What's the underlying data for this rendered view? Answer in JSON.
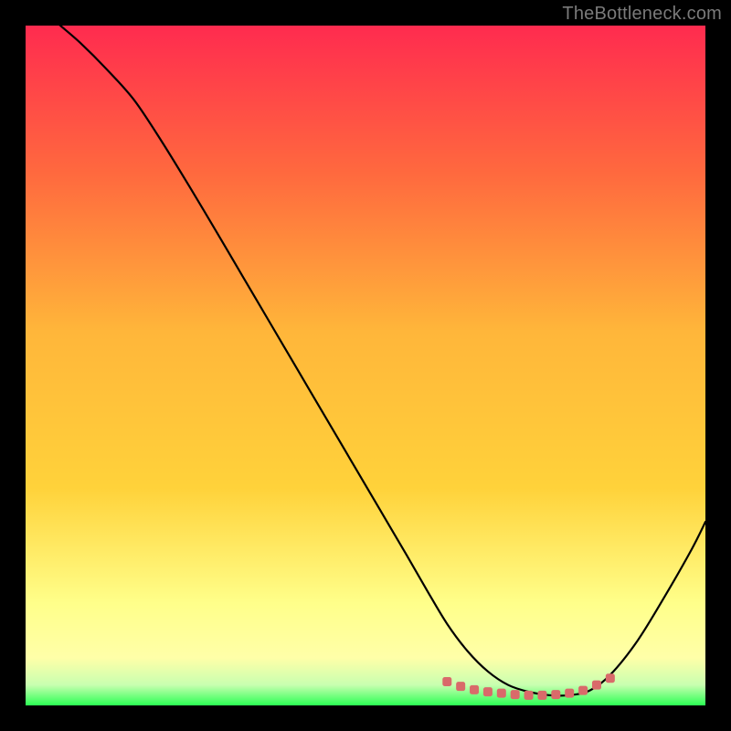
{
  "watermark": "TheBottleneck.com",
  "colors": {
    "background_black": "#000000",
    "gradient_top": "#ff2b4f",
    "gradient_mid_upper": "#ff7a3a",
    "gradient_mid": "#ffd23a",
    "gradient_mid_lower": "#ffff66",
    "gradient_lower": "#ffffa8",
    "gradient_bottom": "#2bff54",
    "curve_color": "#000000",
    "marker_color": "#d96a6a",
    "watermark_color": "#7a7a7a"
  },
  "chart_data": {
    "type": "line",
    "title": "",
    "xlabel": "",
    "ylabel": "",
    "xlim": [
      0,
      100
    ],
    "ylim": [
      0,
      100
    ],
    "grid": false,
    "legend": false,
    "series": [
      {
        "name": "bottleneck-curve",
        "x": [
          0,
          4,
          8,
          12,
          16,
          20,
          24,
          28,
          32,
          36,
          40,
          44,
          48,
          52,
          56,
          59,
          62,
          65,
          68,
          71,
          74,
          77,
          80,
          83,
          86,
          90,
          94,
          98,
          100
        ],
        "y": [
          105,
          101,
          97.5,
          93.5,
          89,
          83,
          76.5,
          69.8,
          63,
          56.2,
          49.4,
          42.6,
          35.8,
          29,
          22.2,
          17,
          12,
          8,
          5,
          3,
          2,
          1.5,
          1.5,
          2.2,
          4.5,
          9.5,
          16,
          23,
          27
        ]
      }
    ],
    "markers": [
      {
        "name": "valley-marker",
        "x": 62,
        "y": 3.5
      },
      {
        "name": "valley-marker",
        "x": 64,
        "y": 2.8
      },
      {
        "name": "valley-marker",
        "x": 66,
        "y": 2.3
      },
      {
        "name": "valley-marker",
        "x": 68,
        "y": 2.0
      },
      {
        "name": "valley-marker",
        "x": 70,
        "y": 1.8
      },
      {
        "name": "valley-marker",
        "x": 72,
        "y": 1.6
      },
      {
        "name": "valley-marker",
        "x": 74,
        "y": 1.5
      },
      {
        "name": "valley-marker",
        "x": 76,
        "y": 1.5
      },
      {
        "name": "valley-marker",
        "x": 78,
        "y": 1.6
      },
      {
        "name": "valley-marker",
        "x": 80,
        "y": 1.8
      },
      {
        "name": "valley-marker",
        "x": 82,
        "y": 2.2
      },
      {
        "name": "valley-marker",
        "x": 84,
        "y": 3.0
      },
      {
        "name": "valley-marker",
        "x": 86,
        "y": 4.0
      }
    ]
  }
}
